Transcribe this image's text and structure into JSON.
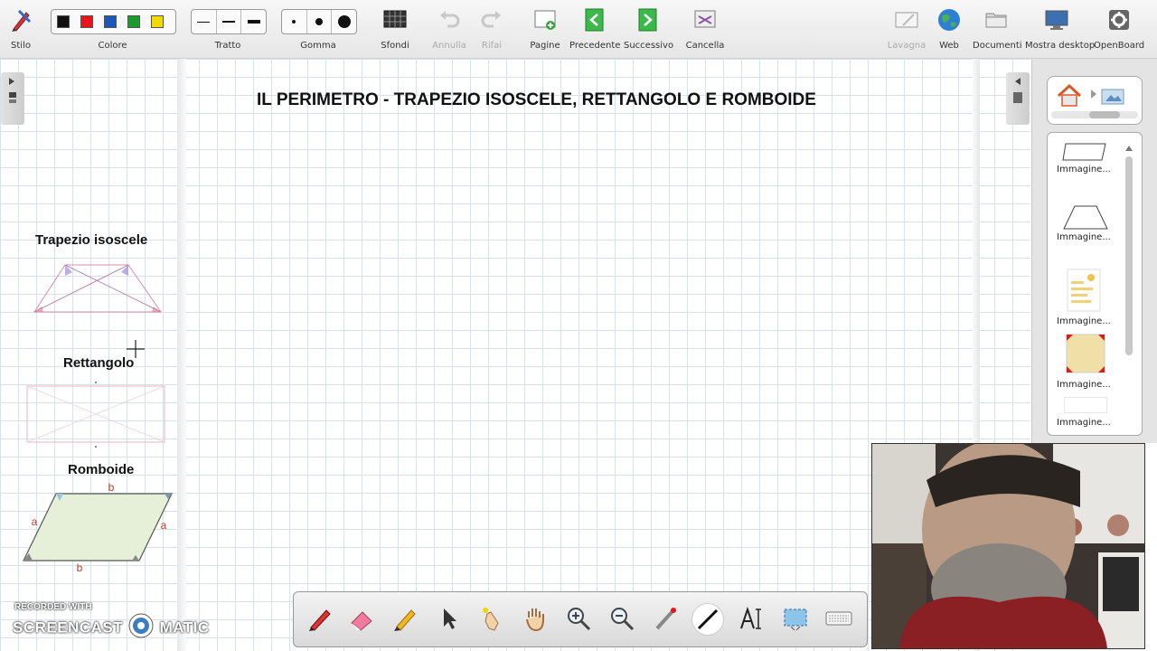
{
  "toolbar": {
    "stilo": "Stilo",
    "colore": "Colore",
    "colors": [
      "#111111",
      "#e8141c",
      "#1f56b8",
      "#1e9a2f",
      "#f5d800"
    ],
    "tratto": "Tratto",
    "gomma": "Gomma",
    "sfondi": "Sfondi",
    "annulla": "Annulla",
    "rifai": "Rifai",
    "pagine": "Pagine",
    "precedente": "Precedente",
    "successivo": "Successivo",
    "cancella": "Cancella",
    "lavagna": "Lavagna",
    "web": "Web",
    "documenti": "Documenti",
    "mostra_desktop": "Mostra desktop",
    "openboard": "OpenBoard"
  },
  "board": {
    "title": "IL PERIMETRO - TRAPEZIO ISOSCELE, RETTANGOLO E ROMBOIDE",
    "shapes": {
      "trapezio": "Trapezio isoscele",
      "rettangolo": "Rettangolo",
      "romboide": "Romboide"
    },
    "romboide_sides": {
      "top": "b",
      "bottom": "b",
      "left": "a",
      "right": "a"
    }
  },
  "library": {
    "thumbnails": [
      "Immagine...",
      "Immagine...",
      "Immagine...",
      "Immagine...",
      "Immagine..."
    ]
  },
  "watermark": {
    "line1": "RECORDED WITH",
    "line2a": "SCREENCAST",
    "line2b": "MATIC"
  }
}
